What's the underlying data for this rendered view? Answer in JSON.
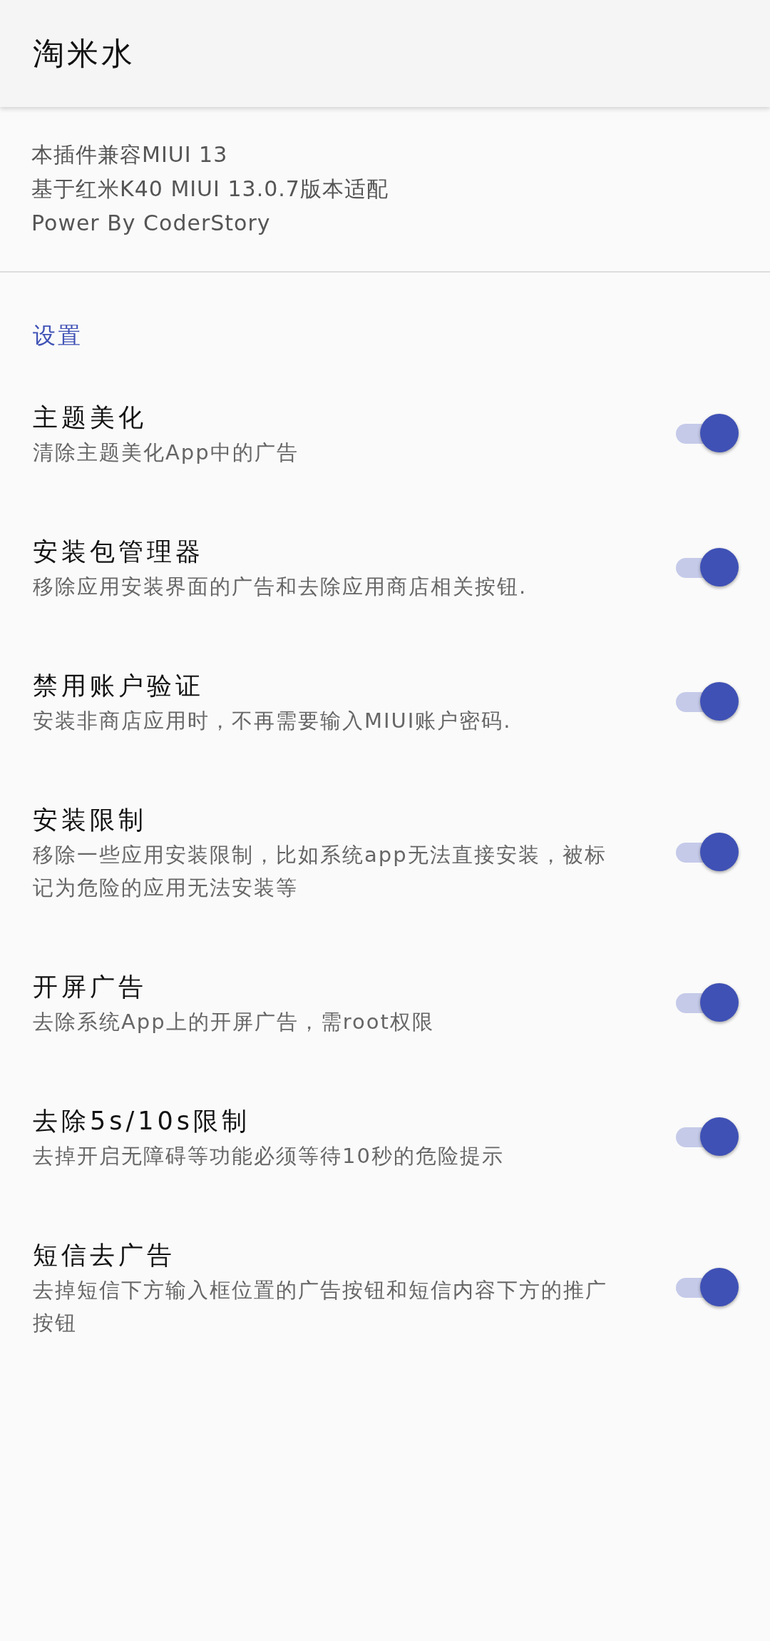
{
  "app_bar": {
    "title": "淘米水"
  },
  "info": [
    "本插件兼容MIUI 13",
    "基于红米K40 MIUI 13.0.7版本适配",
    "Power By CoderStory"
  ],
  "section": {
    "title": "设置"
  },
  "settings": [
    {
      "title": "主题美化",
      "summary": "清除主题美化App中的广告",
      "on": true
    },
    {
      "title": "安装包管理器",
      "summary": "移除应用安装界面的广告和去除应用商店相关按钮.",
      "on": true
    },
    {
      "title": "禁用账户验证",
      "summary": "安装非商店应用时，不再需要输入MIUI账户密码.",
      "on": true
    },
    {
      "title": "安装限制",
      "summary": "移除一些应用安装限制，比如系统app无法直接安装，被标记为危险的应用无法安装等",
      "on": true
    },
    {
      "title": "开屏广告",
      "summary": "去除系统App上的开屏广告，需root权限",
      "on": true
    },
    {
      "title": "去除5s/10s限制",
      "summary": "去掉开启无障碍等功能必须等待10秒的危险提示",
      "on": true
    },
    {
      "title": "短信去广告",
      "summary": "去掉短信下方输入框位置的广告按钮和短信内容下方的推广按钮",
      "on": true
    }
  ]
}
